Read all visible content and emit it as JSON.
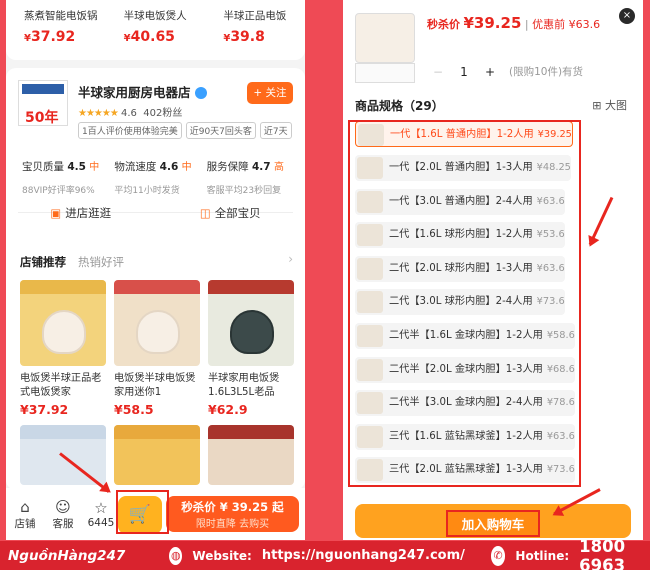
{
  "left": {
    "top_products": [
      {
        "name": "蒸煮智能电饭锅",
        "currency": "¥",
        "price": "37.92"
      },
      {
        "name": "半球电饭煲人",
        "currency": "¥",
        "price": "40.65"
      },
      {
        "name": "半球正品电饭",
        "currency": "¥",
        "price": "39.8"
      }
    ],
    "shop": {
      "logo_text": "50年",
      "name": "半球家用厨房电器店",
      "rating": "4.6",
      "fans": "402粉丝",
      "follow_label": "+ 关注",
      "tags": [
        "1百人评价使用体验完美",
        "近90天7回头客",
        "近7天"
      ],
      "metrics": [
        {
          "label": "宝贝质量",
          "value": "4.5",
          "level": "中",
          "sub": "88VIP好评率96%"
        },
        {
          "label": "物流速度",
          "value": "4.6",
          "level": "中",
          "sub": "平均11小时发货"
        },
        {
          "label": "服务保障",
          "value": "4.7",
          "level": "高",
          "sub": "客服平均23秒回复"
        }
      ],
      "enter_store": "进店逛逛",
      "all_items": "全部宝贝"
    },
    "recommend": {
      "tab_active": "店铺推荐",
      "tab_other": "热销好评",
      "items": [
        {
          "name": "电饭煲半球正品老式电饭煲家",
          "currency": "¥",
          "price": "37.92"
        },
        {
          "name": "电饭煲半球电饭煲家用迷你1",
          "currency": "¥",
          "price": "58.5"
        },
        {
          "name": "半球家用电饭煲1.6L3L5L老品",
          "currency": "¥",
          "price": "62.9"
        }
      ]
    },
    "bottom": {
      "store_label": "店铺",
      "service_label": "客服",
      "fav_count": "6445",
      "buy_price": "秒杀价 ¥ 39.25 起",
      "buy_sub": "限时直降  去购买"
    }
  },
  "right": {
    "price_label": "秒杀价",
    "price": "¥39.25",
    "discount": "优惠前 ¥63.6",
    "close_icon": "×",
    "qty_minus": "−",
    "qty": "1",
    "qty_plus": "+",
    "qty_limit": "(限购10件)有货",
    "spec_title": "商品规格（29）",
    "bigview": "大图",
    "options": [
      {
        "name": "一代【1.6L 普通内胆】1-2人用",
        "price": "¥39.25",
        "selected": true
      },
      {
        "name": "一代【2.0L 普通内胆】1-3人用",
        "price": "¥48.25",
        "selected": false
      },
      {
        "name": "一代【3.0L 普通内胆】2-4人用",
        "price": "¥63.6",
        "selected": false
      },
      {
        "name": "二代【1.6L 球形内胆】1-2人用",
        "price": "¥53.6",
        "selected": false
      },
      {
        "name": "二代【2.0L 球形内胆】1-3人用",
        "price": "¥63.6",
        "selected": false
      },
      {
        "name": "二代【3.0L 球形内胆】2-4人用",
        "price": "¥73.6",
        "selected": false
      },
      {
        "name": "二代半【1.6L 金球内胆】1-2人用",
        "price": "¥58.6",
        "selected": false
      },
      {
        "name": "二代半【2.0L 金球内胆】1-3人用",
        "price": "¥68.6",
        "selected": false
      },
      {
        "name": "二代半【3.0L 金球内胆】2-4人用",
        "price": "¥78.6",
        "selected": false
      },
      {
        "name": "三代【1.6L 蓝钻黑球釜】1-2人用",
        "price": "¥63.6",
        "selected": false
      },
      {
        "name": "三代【2.0L 蓝钻黑球釜】1-3人用",
        "price": "¥73.6",
        "selected": false
      }
    ],
    "add_cart": "加入购物车"
  },
  "banner": {
    "brand": "NguồnHàng247",
    "website_label": "Website:",
    "website": "https://nguonhang247.com/",
    "hotline_label": "Hotline:",
    "hotline": "1800 6963"
  }
}
